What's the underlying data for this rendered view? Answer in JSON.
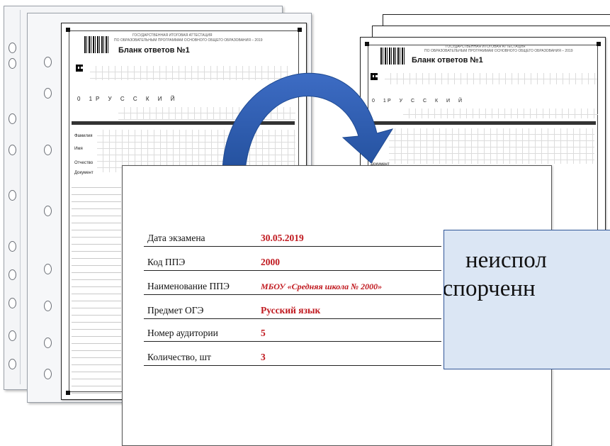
{
  "form": {
    "header_top": "ГОСУДАРСТВЕННАЯ ИТОГОВАЯ АТТЕСТАЦИЯ",
    "header_sub": "ПО ОБРАЗОВАТЕЛЬНЫМ ПРОГРАММАМ ОСНОВНОГО ОБЩЕГО ОБРАЗОВАНИЯ – 2019",
    "title": "Бланк ответов №1",
    "subject_code": "0 1",
    "subject_name": "Р У С С К И Й",
    "field_surname": "Фамилия",
    "field_name": "Имя",
    "field_patronymic": "Отчество",
    "field_document": "Документ"
  },
  "card": {
    "rows": [
      {
        "label": "Дата экзамена",
        "value": "30.05.2019"
      },
      {
        "label": "Код ППЭ",
        "value": "2000"
      },
      {
        "label": "Наименование ППЭ",
        "value": "МБОУ «Средняя школа № 2000»"
      },
      {
        "label": "Предмет ОГЭ",
        "value": "Русский язык"
      },
      {
        "label": "Номер аудитории",
        "value": "5"
      },
      {
        "label": "Количество, шт",
        "value": "3"
      }
    ]
  },
  "callout": {
    "line1": "неиспол",
    "line2": "испорченн"
  },
  "colors": {
    "value_red": "#c0191f",
    "arrow_blue": "#2f5bb0",
    "callout_fill": "#dbe6f4",
    "callout_border": "#2f5597"
  }
}
